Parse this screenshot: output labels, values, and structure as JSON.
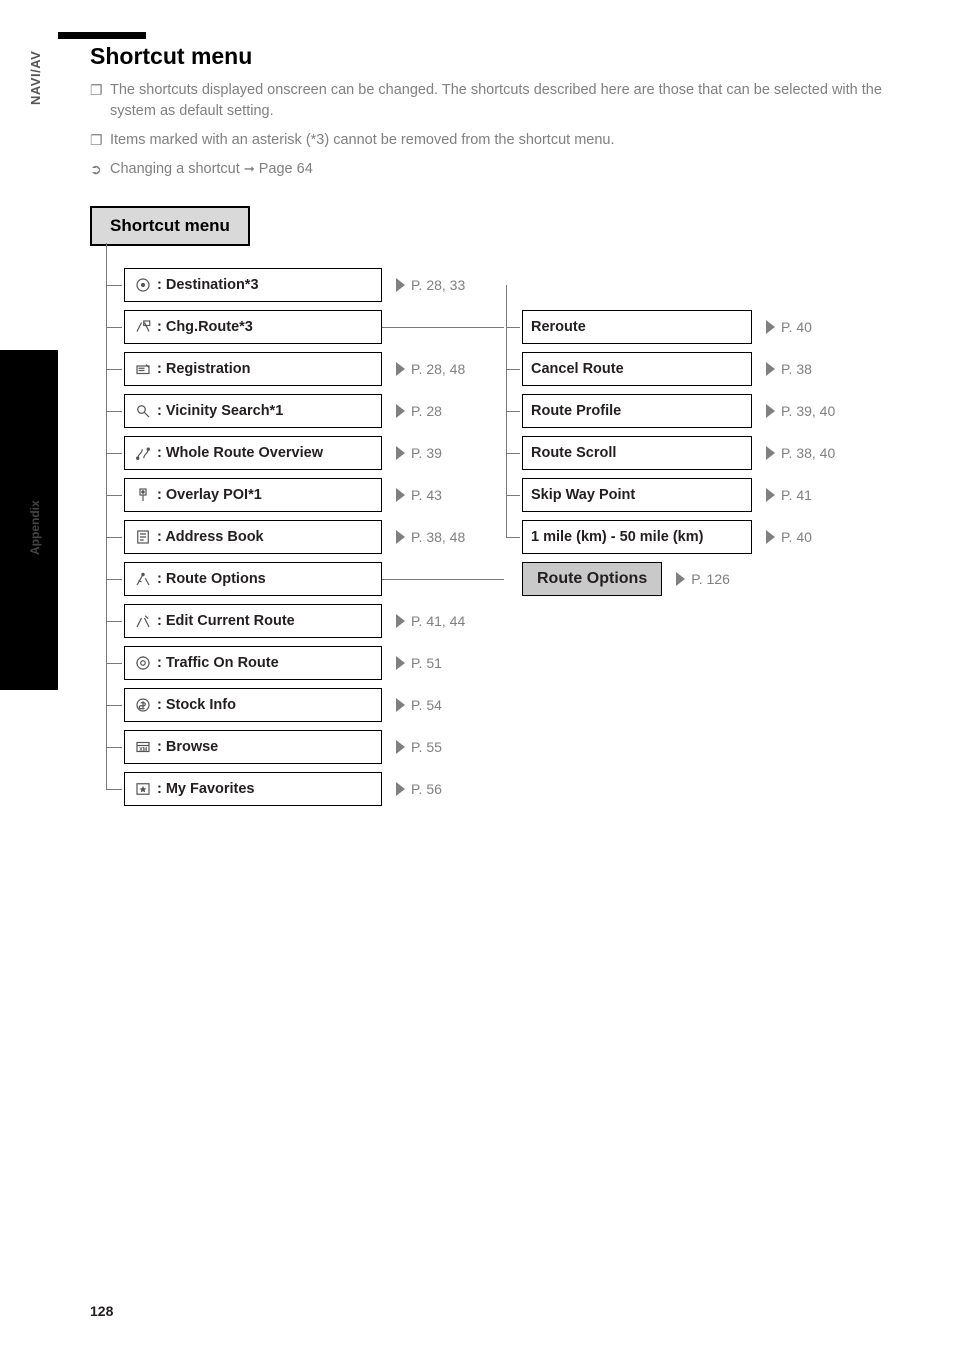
{
  "side": {
    "top_label": "NAVI/AV",
    "mid_label": "Appendix"
  },
  "title": "Shortcut menu",
  "notes": {
    "n1": "The shortcuts displayed onscreen can be changed. The shortcuts described here are those that can be selected with the system as default setting.",
    "n2": "Items marked with an asterisk (*3) cannot be removed from the shortcut menu.",
    "n3_prefix": "Changing a shortcut",
    "n3_suffix": "Page 64"
  },
  "menu_header": "Shortcut menu",
  "left_items": [
    {
      "icon": "destination-icon",
      "label": ": Destination*3",
      "page": "P. 28, 33"
    },
    {
      "icon": "chgroute-icon",
      "label": ": Chg.Route*3",
      "page": ""
    },
    {
      "icon": "registration-icon",
      "label": ": Registration",
      "page": "P. 28, 48"
    },
    {
      "icon": "vicinity-icon",
      "label": ": Vicinity Search*1",
      "page": "P. 28"
    },
    {
      "icon": "wholeroute-icon",
      "label": ": Whole Route Overview",
      "page": "P. 39"
    },
    {
      "icon": "overlaypoi-icon",
      "label": " : Overlay POI*1",
      "page": "P. 43"
    },
    {
      "icon": "addressbook-icon",
      "label": ": Address Book",
      "page": "P. 38, 48"
    },
    {
      "icon": "routeoptions-icon",
      "label": ": Route Options",
      "page": ""
    },
    {
      "icon": "editroute-icon",
      "label": ": Edit Current Route",
      "page": "P. 41, 44"
    },
    {
      "icon": "traffic-icon",
      "label": ": Traffic On Route",
      "page": "P. 51"
    },
    {
      "icon": "stock-icon",
      "label": ": Stock Info",
      "page": "P. 54"
    },
    {
      "icon": "browse-icon",
      "label": ": Browse",
      "page": "P. 55"
    },
    {
      "icon": "favorites-icon",
      "label": ": My Favorites",
      "page": "P. 56"
    }
  ],
  "right_items": [
    {
      "label": "Reroute",
      "page": "P. 40"
    },
    {
      "label": "Cancel Route",
      "page": "P. 38"
    },
    {
      "label": "Route Profile",
      "page": "P. 39, 40"
    },
    {
      "label": "Route Scroll",
      "page": "P. 38, 40"
    },
    {
      "label": "Skip Way Point",
      "page": "P. 41"
    },
    {
      "label": "1 mile (km) - 50 mile (km)",
      "page": "P. 40"
    }
  ],
  "sub_header": {
    "label": "Route Options",
    "page": "P. 126"
  },
  "page_number": "128"
}
